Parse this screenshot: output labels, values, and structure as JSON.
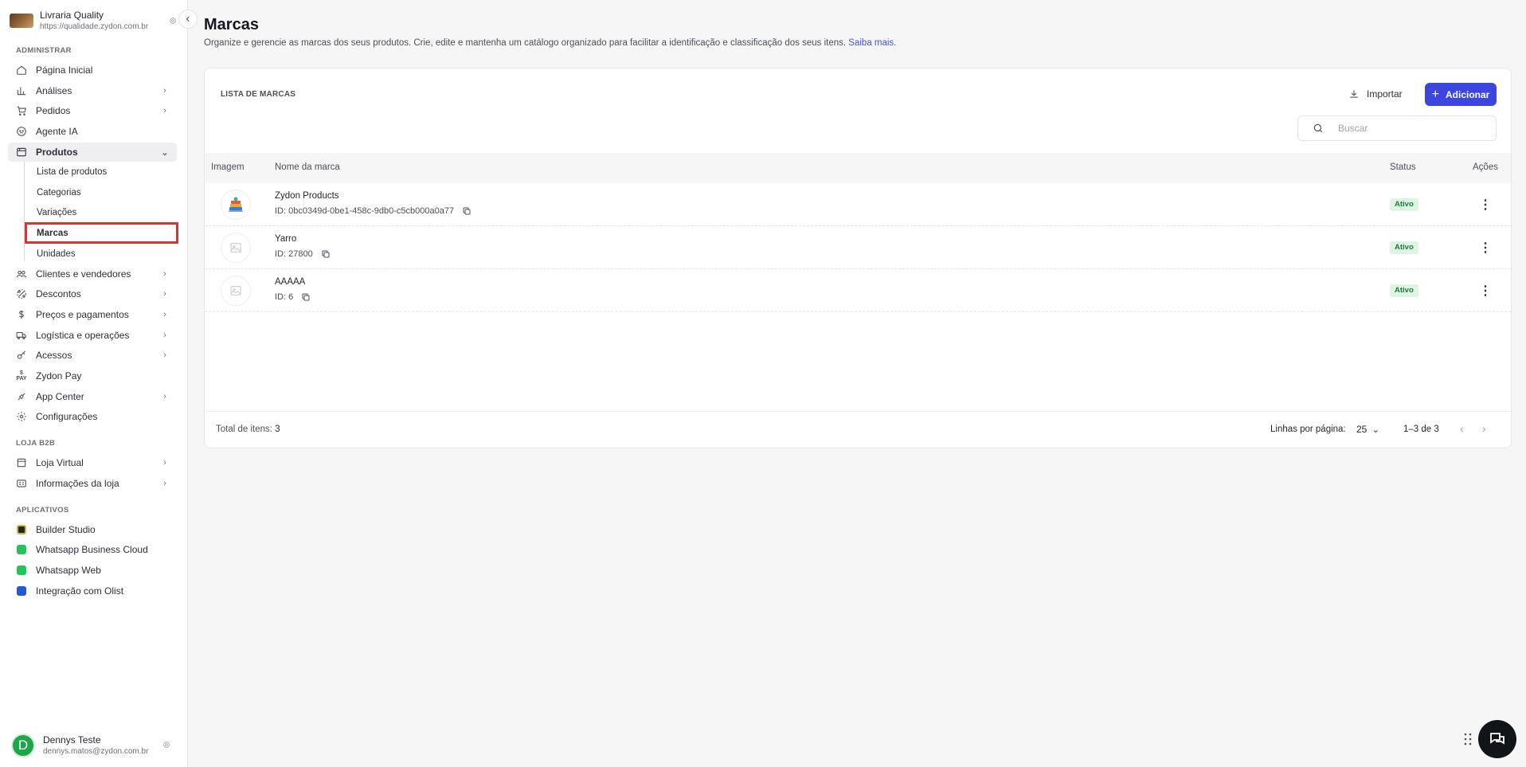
{
  "sidebar": {
    "store_name": "Livraria Quality",
    "store_url": "https://qualidade.zydon.com.br",
    "sections": {
      "admin": "ADMINISTRAR",
      "b2b": "LOJA B2B",
      "apps": "APLICATIVOS"
    },
    "items": {
      "home": "Página Inicial",
      "analytics": "Análises",
      "orders": "Pedidos",
      "ai_agent": "Agente IA",
      "products": "Produtos",
      "clients": "Clientes e vendedores",
      "discounts": "Descontos",
      "prices": "Preços e pagamentos",
      "logistics": "Logística e operações",
      "access": "Acessos",
      "pay": "Zydon Pay",
      "app_center": "App Center",
      "settings": "Configurações",
      "virtual_store": "Loja Virtual",
      "store_info": "Informações da loja"
    },
    "products_sub": {
      "list": "Lista de produtos",
      "categories": "Categorias",
      "variations": "Variações",
      "brands": "Marcas",
      "units": "Unidades"
    },
    "apps": {
      "builder": "Builder Studio",
      "wa_cloud": "Whatsapp Business Cloud",
      "wa_web": "Whatsapp Web",
      "olist": "Integração com Olist"
    },
    "pay_icon_text": "PAY",
    "user": {
      "initial": "D",
      "name": "Dennys Teste",
      "email": "dennys.matos@zydon.com.br"
    }
  },
  "page": {
    "title": "Marcas",
    "description": "Organize e gerencie as marcas dos seus produtos. Crie, edite e mantenha um catálogo organizado para facilitar a identificação e classificação dos seus itens.",
    "learn_more": "Saiba mais."
  },
  "card": {
    "title": "LISTA DE MARCAS",
    "import_label": "Importar",
    "add_label": "Adicionar",
    "search_placeholder": "Buscar",
    "columns": {
      "image": "Imagem",
      "name": "Nome da marca",
      "status": "Status",
      "actions": "Ações"
    },
    "rows": [
      {
        "name": "Zydon Products",
        "id": "ID: 0bc0349d-0be1-458c-9db0-c5cb000a0a77",
        "status": "Ativo"
      },
      {
        "name": "Yarro",
        "id": "ID: 27800",
        "status": "Ativo"
      },
      {
        "name": "AAAAA",
        "id": "ID: 6",
        "status": "Ativo"
      }
    ],
    "footer": {
      "total_label": "Total de itens:",
      "total_value": "3",
      "rows_per_page_label": "Linhas por página:",
      "rows_per_page_value": "25",
      "range": "1–3 de 3"
    }
  },
  "colors": {
    "primary": "#3c46de",
    "active_badge_bg": "#dff5e4",
    "active_badge_text": "#1d7a3a",
    "highlight": "#e03131"
  }
}
